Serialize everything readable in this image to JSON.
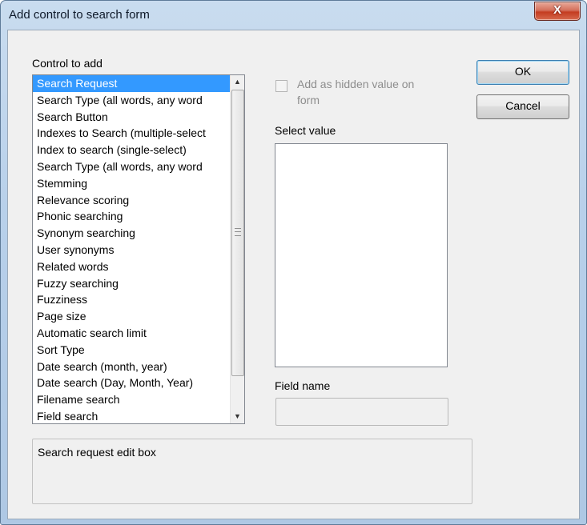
{
  "window": {
    "title": "Add control to search form",
    "close_glyph": "X"
  },
  "controls": {
    "list_label": "Control to add",
    "items": [
      "Search Request",
      "Search Type (all words, any word",
      "Search Button",
      "Indexes to Search (multiple-select",
      "Index to search (single-select)",
      "Search Type (all words, any word",
      "Stemming",
      "Relevance scoring",
      "Phonic searching",
      "Synonym searching",
      "User synonyms",
      "Related words",
      "Fuzzy searching",
      "Fuzziness",
      "Page size",
      "Automatic search limit",
      "Sort Type",
      "Date search (month, year)",
      "Date search (Day, Month, Year)",
      "Filename search",
      "Field search"
    ],
    "selected_index": 0,
    "scroll_up_glyph": "▲",
    "scroll_down_glyph": "▼"
  },
  "options": {
    "hidden_checkbox_label_line1": "Add as hidden value on",
    "hidden_checkbox_label_line2": "form",
    "select_value_label": "Select value",
    "field_name_label": "Field name"
  },
  "description": {
    "text": "Search request edit box"
  },
  "buttons": {
    "ok": "OK",
    "cancel": "Cancel"
  },
  "colors": {
    "selection": "#3399ff",
    "close_button": "#c43c20"
  }
}
